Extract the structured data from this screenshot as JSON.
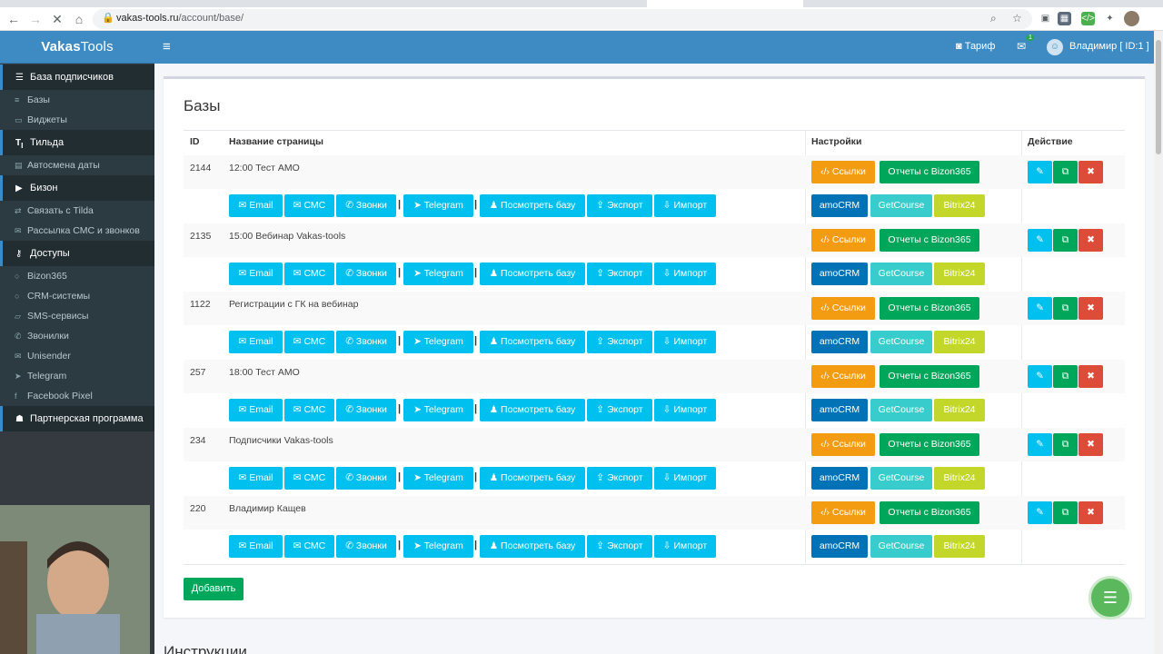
{
  "browser": {
    "url_host": "vakas-tools.ru",
    "url_path": "/account/base/"
  },
  "brand": {
    "name_bold": "Vakas",
    "name_rest": "Tools"
  },
  "topbar": {
    "tarif": "Тариф",
    "mail_badge": "1",
    "user": "Владимир [ ID:1 ]"
  },
  "sidebar": {
    "sections": [
      {
        "label": "База подписчиков",
        "icon": "database-icon",
        "items": [
          {
            "label": "Базы",
            "icon": "database-icon"
          },
          {
            "label": "Виджеты",
            "icon": "widget-icon"
          }
        ]
      },
      {
        "label": "Тильда",
        "icon": "tilda-icon",
        "items": [
          {
            "label": "Автосмена даты",
            "icon": "calendar-icon"
          }
        ]
      },
      {
        "label": "Бизон",
        "icon": "youtube-icon",
        "items": [
          {
            "label": "Связать с Tilda",
            "icon": "link-icon"
          },
          {
            "label": "Рассылка СМС и звонков",
            "icon": "envelope-icon"
          }
        ]
      },
      {
        "label": "Доступы",
        "icon": "key-icon",
        "items": [
          {
            "label": "Bizon365",
            "icon": "circle-icon"
          },
          {
            "label": "CRM-системы",
            "icon": "circle-icon"
          },
          {
            "label": "SMS-сервисы",
            "icon": "sms-icon"
          },
          {
            "label": "Звонилки",
            "icon": "phone-icon"
          },
          {
            "label": "Unisender",
            "icon": "envelope-icon"
          },
          {
            "label": "Telegram",
            "icon": "telegram-icon"
          },
          {
            "label": "Facebook Pixel",
            "icon": "facebook-icon"
          }
        ]
      },
      {
        "label": "Партнерская программа",
        "icon": "users-icon",
        "items": []
      }
    ]
  },
  "main": {
    "title": "Базы",
    "headers": {
      "id": "ID",
      "name": "Название страницы",
      "settings": "Настройки",
      "action": "Действие"
    },
    "actions": {
      "email": "Email",
      "sms": "СМС",
      "calls": "Звонки",
      "telegram": "Telegram",
      "view": "Посмотреть базу",
      "export": "Экспорт",
      "import": "Импорт"
    },
    "settings": {
      "links": "Ссылки",
      "reports": "Отчеты с Bizon365",
      "amocrm": "amoCRM",
      "getcourse": "GetCourse",
      "bitrix": "Bitrix24"
    },
    "rows": [
      {
        "id": "2144",
        "name": "12:00 Тест АМО"
      },
      {
        "id": "2135",
        "name": "15:00 Вебинар Vakas-tools"
      },
      {
        "id": "1122",
        "name": "Регистрации с ГК на вебинар"
      },
      {
        "id": "257",
        "name": "18:00 Тест АМО"
      },
      {
        "id": "234",
        "name": "Подписчики Vakas-tools"
      },
      {
        "id": "220",
        "name": "Владимир Кащев"
      }
    ],
    "add_button": "Добавить"
  },
  "next_section": "Инструкции",
  "colors": {
    "header": "#3d8bc2",
    "sidebar": "#343a40",
    "cyan": "#00c0ef",
    "orange": "#f39c12",
    "green": "#00a65a",
    "navy": "#0073b7",
    "teal": "#39cccc",
    "lime": "#c2d72a",
    "red": "#dd4b39"
  }
}
